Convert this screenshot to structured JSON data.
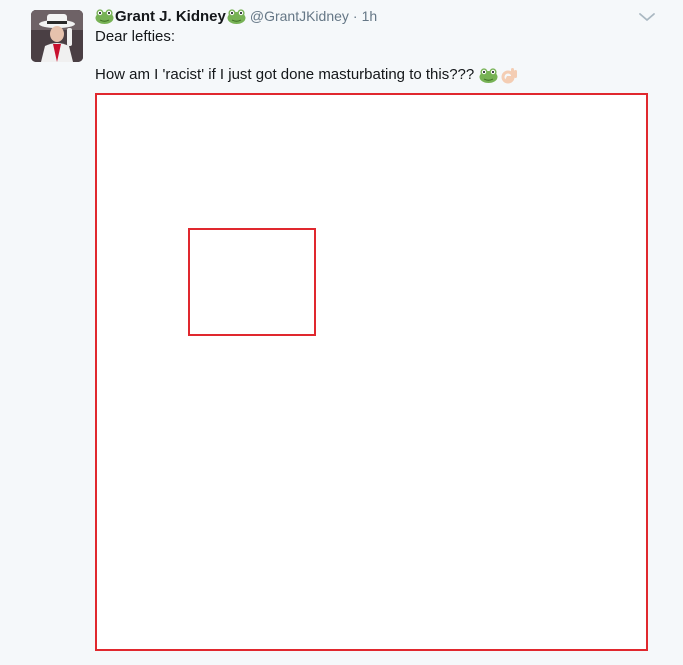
{
  "tweet": {
    "display_name": "Grant J. Kidney",
    "handle": "@GrantJKidney",
    "separator": "·",
    "time": "1h",
    "text_line1": "Dear lefties:",
    "text_line2": "How am I 'racist' if I just got done masturbating to this???",
    "icons": {
      "name_prefix": "frog-icon",
      "name_suffix": "frog-icon",
      "text_emoji_1": "frog-icon",
      "text_emoji_2": "ok-hand-icon",
      "menu": "chevron-down-icon"
    }
  },
  "colors": {
    "background": "#f5f8fa",
    "name": "#14171a",
    "secondary": "#657786",
    "annotation_red": "#e0282e",
    "frog_green": "#77b255"
  }
}
